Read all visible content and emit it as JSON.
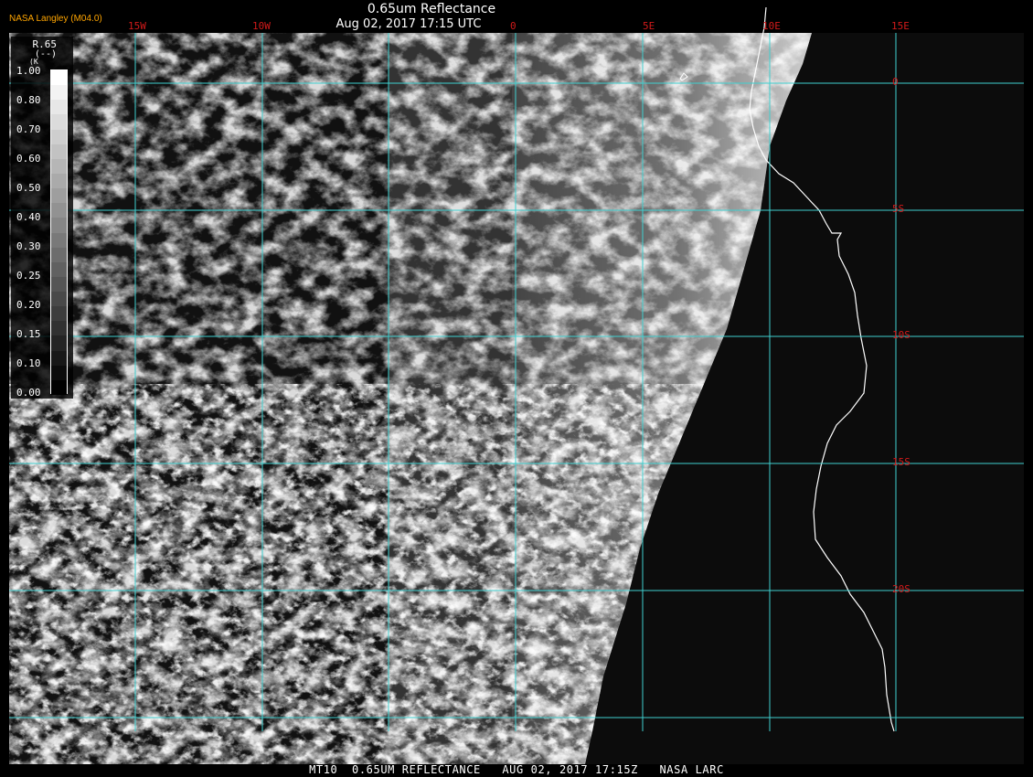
{
  "header": {
    "title": "0.65um Reflectance",
    "subtitle": "Aug 02, 2017 17:15 UTC",
    "org": "NASA Langley (M04.0)"
  },
  "legend": {
    "title": "R.65",
    "unit": "(--)",
    "k_label": "(K",
    "ticks": [
      "1.00",
      "0.80",
      "0.70",
      "0.60",
      "0.50",
      "0.40",
      "0.30",
      "0.25",
      "0.20",
      "0.15",
      "0.10",
      "0.00"
    ]
  },
  "grid": {
    "line_color": "#3fd0d0",
    "label_color": "#d21a1a",
    "lon_labels": [
      "15W",
      "10W",
      "0",
      "5E",
      "10E",
      "15E"
    ],
    "lat_labels": [
      "0",
      "5S",
      "10S",
      "15S",
      "20S"
    ]
  },
  "colors": {
    "coast": "#ffffff",
    "space": "#0c0c0c"
  },
  "footer": {
    "text": "MT10  0.65UM REFLECTANCE   AUG 02, 2017 17:15Z   NASA LARC"
  }
}
